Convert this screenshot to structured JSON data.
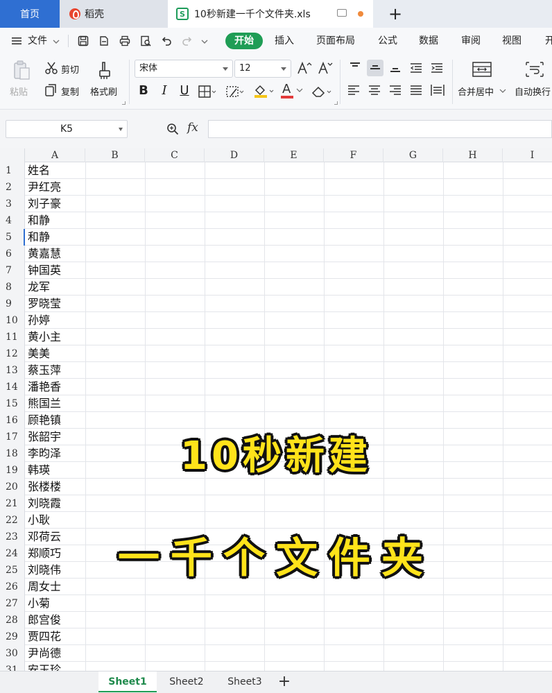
{
  "tabs": {
    "home": "首页",
    "daoke": "稻壳",
    "file": "10秒新建一千个文件夹.xls",
    "file_icon": "S",
    "new_tab": "+"
  },
  "menu": {
    "file": "文件",
    "items": [
      "开始",
      "插入",
      "页面布局",
      "公式",
      "数据",
      "审阅",
      "视图",
      "开"
    ]
  },
  "ribbon": {
    "paste": "粘贴",
    "cut": "剪切",
    "copy": "复制",
    "format_painter": "格式刷",
    "font_name": "宋体",
    "font_size": "12",
    "bold": "B",
    "italic": "I",
    "underline": "U",
    "font_color_glyph": "A",
    "merge_center": "合并居中",
    "auto_wrap": "自动换行"
  },
  "formula_bar": {
    "cell_ref": "K5",
    "fx": "fx",
    "value": ""
  },
  "grid": {
    "columns": [
      "A",
      "B",
      "C",
      "D",
      "E",
      "F",
      "G",
      "H",
      "I"
    ],
    "selected_row": 5,
    "rows": [
      {
        "n": "1",
        "a": "姓名"
      },
      {
        "n": "2",
        "a": "尹红亮"
      },
      {
        "n": "3",
        "a": "刘子豪"
      },
      {
        "n": "4",
        "a": "和静"
      },
      {
        "n": "5",
        "a": "和静"
      },
      {
        "n": "6",
        "a": "黄嘉慧"
      },
      {
        "n": "7",
        "a": "钟国英"
      },
      {
        "n": "8",
        "a": "龙军"
      },
      {
        "n": "9",
        "a": "罗晓莹"
      },
      {
        "n": "10",
        "a": "孙婷"
      },
      {
        "n": "11",
        "a": "黄小主"
      },
      {
        "n": "12",
        "a": "美美"
      },
      {
        "n": "13",
        "a": "蔡玉萍"
      },
      {
        "n": "14",
        "a": "潘艳香"
      },
      {
        "n": "15",
        "a": "熊国兰"
      },
      {
        "n": "16",
        "a": "顾艳镇"
      },
      {
        "n": "17",
        "a": "张韶宇"
      },
      {
        "n": "18",
        "a": "李昀泽"
      },
      {
        "n": "19",
        "a": "韩瑛"
      },
      {
        "n": "20",
        "a": "张楼楼"
      },
      {
        "n": "21",
        "a": "刘晓霞"
      },
      {
        "n": "22",
        "a": "小耿"
      },
      {
        "n": "23",
        "a": "邓荷云"
      },
      {
        "n": "24",
        "a": "郑顺巧"
      },
      {
        "n": "25",
        "a": "刘晓伟"
      },
      {
        "n": "26",
        "a": "周女士"
      },
      {
        "n": "27",
        "a": "小菊"
      },
      {
        "n": "28",
        "a": "郎宫俊"
      },
      {
        "n": "29",
        "a": "贾四花"
      },
      {
        "n": "30",
        "a": "尹尚德"
      },
      {
        "n": "31",
        "a": "安玉珍"
      }
    ]
  },
  "overlay": {
    "line1": "10秒新建",
    "line2": "一千个文件夹"
  },
  "sheets": {
    "tabs": [
      "Sheet1",
      "Sheet2",
      "Sheet3"
    ],
    "active": "Sheet1",
    "add": "+"
  },
  "colors": {
    "brand_blue": "#2f6fd2",
    "start_green": "#1f9d55",
    "overlay_yellow": "#ffe31a"
  }
}
